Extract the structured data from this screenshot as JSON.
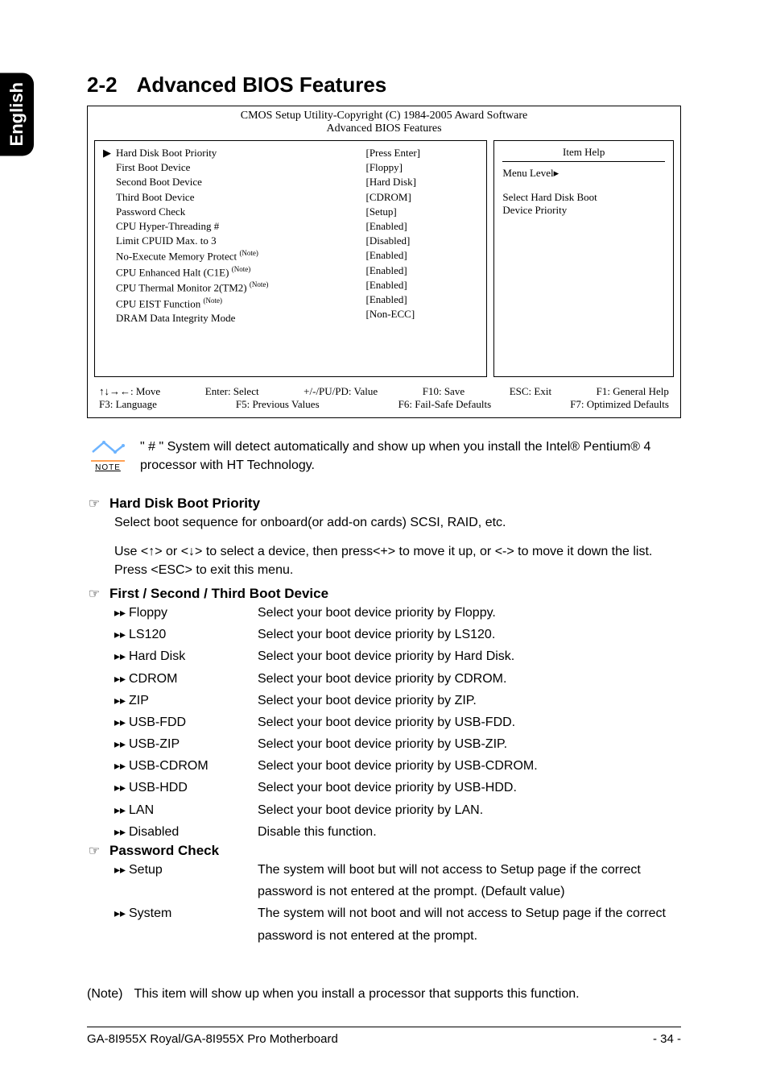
{
  "side_tab": "English",
  "heading": {
    "num": "2-2",
    "title": "Advanced BIOS Features"
  },
  "bios": {
    "header_line1": "CMOS Setup Utility-Copyright (C) 1984-2005 Award Software",
    "header_line2": "Advanced BIOS Features",
    "items": [
      {
        "label": "Hard Disk Boot Priority",
        "value": "[Press Enter]",
        "selected": true,
        "note": false
      },
      {
        "label": "First Boot Device",
        "value": "[Floppy]",
        "selected": false,
        "note": false
      },
      {
        "label": "Second Boot Device",
        "value": "[Hard Disk]",
        "selected": false,
        "note": false
      },
      {
        "label": "Third Boot Device",
        "value": "[CDROM]",
        "selected": false,
        "note": false
      },
      {
        "label": "Password Check",
        "value": "[Setup]",
        "selected": false,
        "note": false
      },
      {
        "label": "CPU Hyper-Threading #",
        "value": "[Enabled]",
        "selected": false,
        "note": false
      },
      {
        "label": "Limit CPUID Max. to 3",
        "value": "[Disabled]",
        "selected": false,
        "note": false
      },
      {
        "label": "No-Execute Memory Protect",
        "value": "[Enabled]",
        "selected": false,
        "note": true
      },
      {
        "label": "CPU Enhanced Halt (C1E)",
        "value": "[Enabled]",
        "selected": false,
        "note": true
      },
      {
        "label": "CPU Thermal Monitor 2(TM2)",
        "value": "[Enabled]",
        "selected": false,
        "note": true
      },
      {
        "label": "CPU EIST Function",
        "value": "[Enabled]",
        "selected": false,
        "note": true
      },
      {
        "label": "DRAM Data Integrity Mode",
        "value": "[Non-ECC]",
        "selected": false,
        "note": false
      }
    ],
    "note_tag": "(Note)",
    "help": {
      "title": "Item Help",
      "menu_level_label": "Menu Level",
      "desc1": "Select Hard Disk Boot",
      "desc2": "Device Priority"
    },
    "footer": {
      "r1": {
        "a": "↑↓→←: Move",
        "b": "Enter: Select",
        "c": "+/-/PU/PD: Value",
        "d": "F10: Save",
        "e": "ESC: Exit",
        "f": "F1: General Help"
      },
      "r2": {
        "a": "F3: Language",
        "b": "F5: Previous Values",
        "c": "F6: Fail-Safe Defaults",
        "d": "F7: Optimized Defaults"
      }
    }
  },
  "note_block": {
    "label": "NOTE",
    "text": "\" # \" System will detect automatically and show up when you install the Intel® Pentium® 4 processor with HT Technology."
  },
  "sections": {
    "hd": {
      "title": "Hard Disk Boot Priority",
      "p1": "Select boot sequence for onboard(or add-on cards) SCSI, RAID, etc.",
      "p2": "Use <↑> or <↓> to select a device, then press<+> to move it up, or <-> to move it down the list. Press <ESC> to exit this menu."
    },
    "bootdev": {
      "title": "First / Second / Third Boot Device",
      "options": [
        {
          "name": "Floppy",
          "desc": "Select your boot device priority by Floppy."
        },
        {
          "name": "LS120",
          "desc": "Select your boot device priority by LS120."
        },
        {
          "name": "Hard Disk",
          "desc": "Select your boot device priority by Hard Disk."
        },
        {
          "name": "CDROM",
          "desc": "Select your boot device priority by CDROM."
        },
        {
          "name": "ZIP",
          "desc": "Select your boot device priority by ZIP."
        },
        {
          "name": "USB-FDD",
          "desc": "Select your boot device priority by USB-FDD."
        },
        {
          "name": "USB-ZIP",
          "desc": "Select your boot device priority by USB-ZIP."
        },
        {
          "name": "USB-CDROM",
          "desc": "Select your boot device priority by USB-CDROM."
        },
        {
          "name": "USB-HDD",
          "desc": "Select your boot device priority by USB-HDD."
        },
        {
          "name": "LAN",
          "desc": "Select your boot device priority by LAN."
        },
        {
          "name": "Disabled",
          "desc": "Disable this function."
        }
      ]
    },
    "pwd": {
      "title": "Password Check",
      "options": [
        {
          "name": "Setup",
          "desc": "The system will boot but will not access to Setup page if the correct password is not entered at the prompt. (Default value)"
        },
        {
          "name": "System",
          "desc": "The system will not boot and will not access to Setup page if the correct password is not entered at the prompt."
        }
      ]
    }
  },
  "footnote": {
    "tag": "(Note)",
    "text": "This item will show up when you install a processor that supports this function."
  },
  "footer": {
    "title": "GA-8I955X Royal/GA-8I955X Pro Motherboard",
    "page": "- 34 -"
  }
}
